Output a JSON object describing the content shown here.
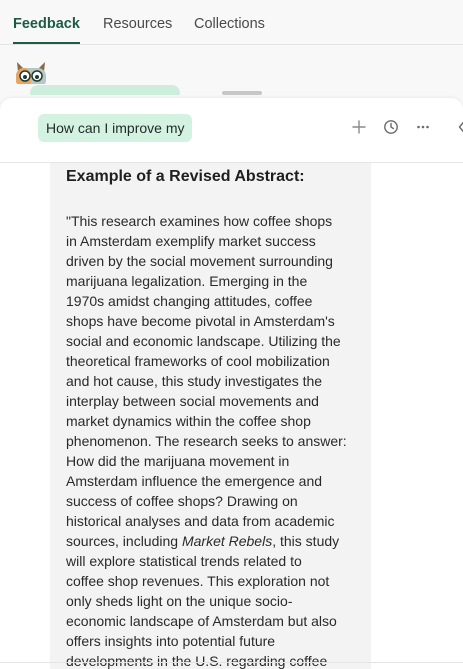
{
  "tabs": [
    {
      "label": "Feedback",
      "active": true
    },
    {
      "label": "Resources",
      "active": false
    },
    {
      "label": "Collections",
      "active": false
    }
  ],
  "avatar_icon": "cat-avatar-icon",
  "panel": {
    "query_chip": "How can I improve my",
    "icons": [
      "plus-icon",
      "history-icon",
      "more-icon",
      "collapse-icon"
    ]
  },
  "content": {
    "heading": "Example of a Revised Abstract:",
    "lines": [
      "\"This research examines how coffee shops",
      "in Amsterdam exemplify market success",
      "driven by the social movement surrounding",
      "marijuana legalization. Emerging in the",
      "1970s amidst changing attitudes, coffee",
      "shops have become pivotal in Amsterdam's",
      "social and economic landscape. Utilizing the",
      "theoretical frameworks of cool mobilization",
      "and hot cause, this study investigates the",
      "interplay between social movements and",
      "market dynamics within the coffee shop",
      "phenomenon. The research seeks to answer:",
      "How did the marijuana movement in",
      "Amsterdam influence the emergence and",
      "success of coffee shops? Drawing on",
      "historical analyses and data from academic"
    ],
    "line_16_prefix": "sources, including ",
    "line_16_italic": "Market Rebels",
    "line_16_suffix": ", this study",
    "lines_after": [
      "will explore statistical trends related to",
      "coffee shop revenues. This exploration not",
      "only sheds light on the unique socio-",
      "economic landscape of Amsterdam but also",
      "offers insights into potential future",
      "developments in the U.S. regarding coffee"
    ]
  },
  "colors": {
    "accent": "#1c5b46",
    "chip_bg": "#d4f2e2",
    "content_bg": "#f3f3f3"
  }
}
